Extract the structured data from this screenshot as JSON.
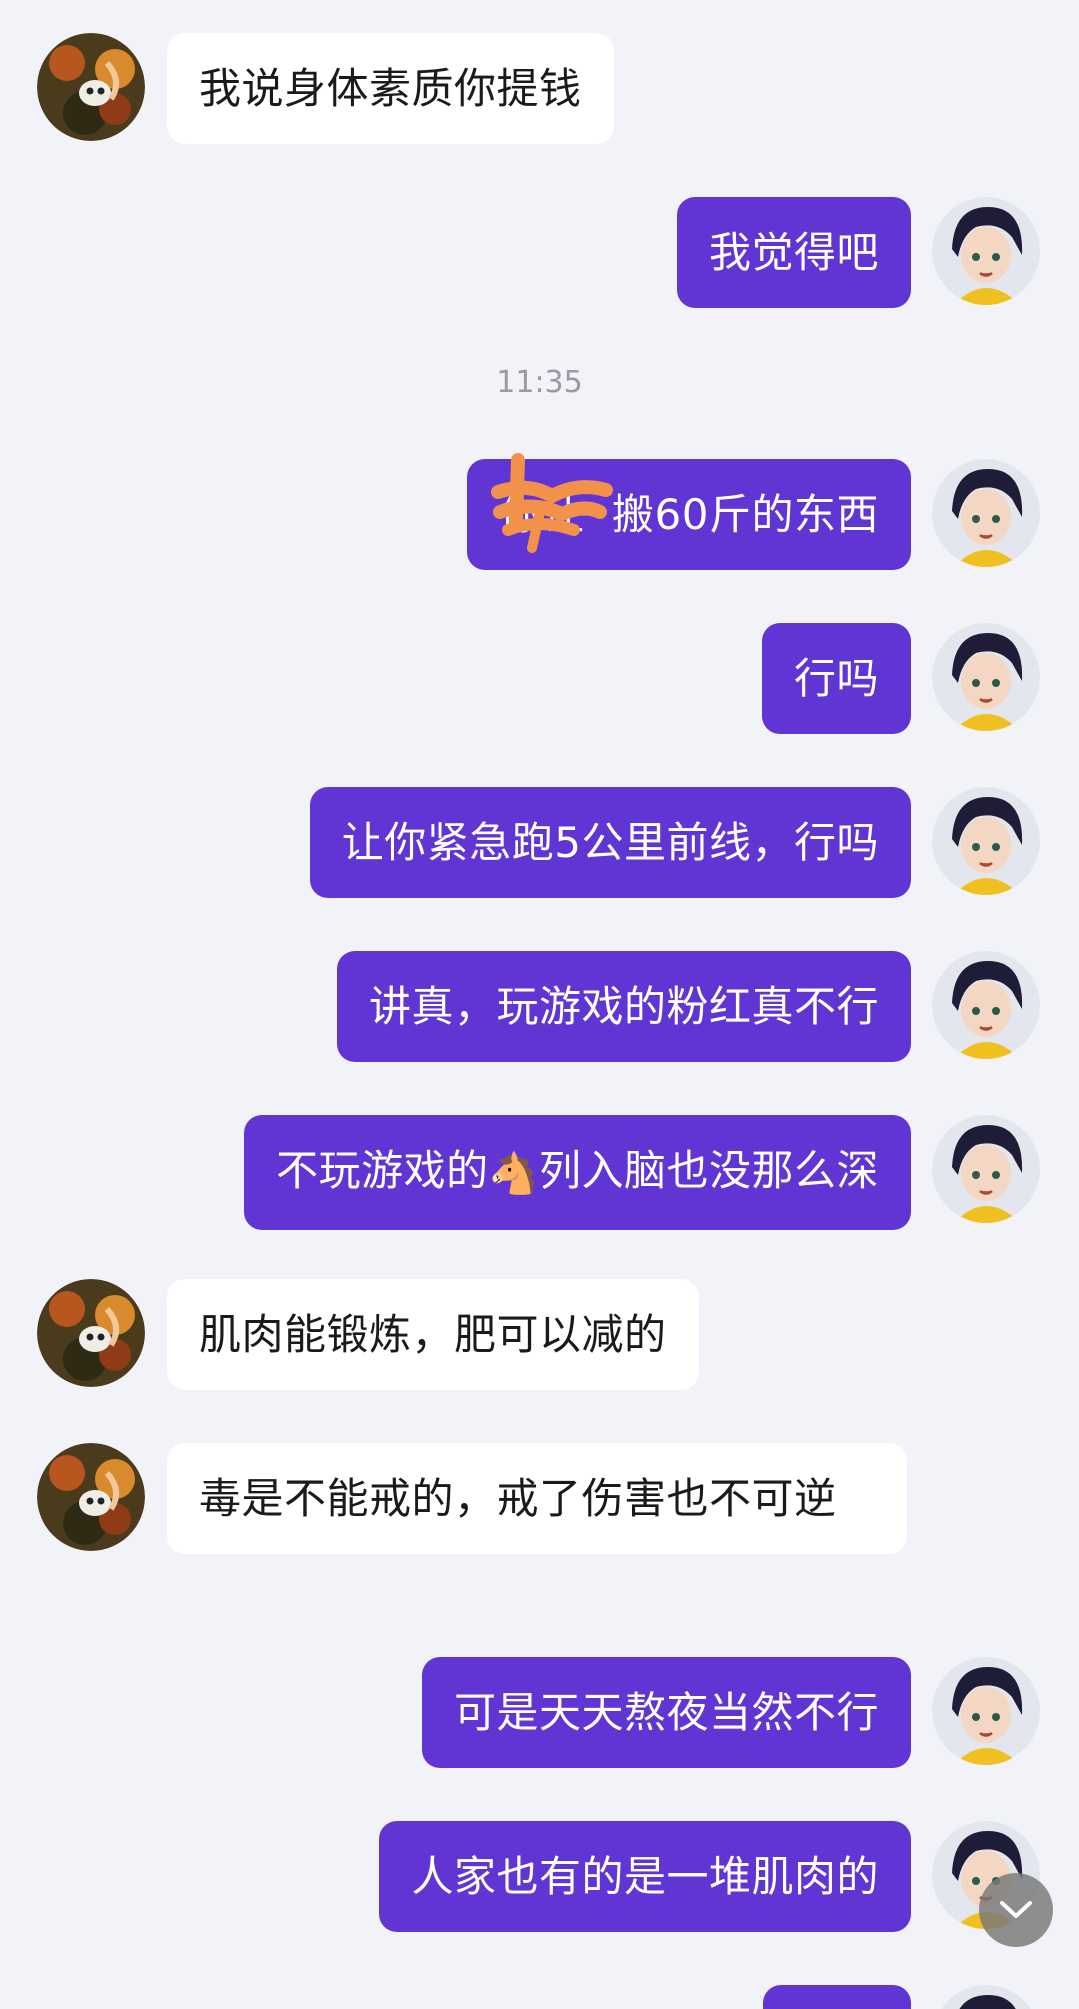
{
  "messages": [
    {
      "side": "incoming",
      "text": "我说身体素质你提钱"
    },
    {
      "side": "outgoing",
      "text": "我觉得吧"
    },
    {
      "side": "outgoing",
      "text": "你让  搬60斤的东西"
    },
    {
      "side": "outgoing",
      "text": "行吗"
    },
    {
      "side": "outgoing",
      "text": "让你紧急跑5公里前线，行吗"
    },
    {
      "side": "outgoing",
      "text": "讲真，玩游戏的粉红真不行"
    },
    {
      "side": "outgoing",
      "text_before": "不玩游戏的",
      "emoji": "🐴",
      "text_after": "列入脑也没那么深"
    },
    {
      "side": "incoming",
      "text": "肌肉能锻炼，肥可以减的"
    },
    {
      "side": "incoming",
      "text": "毒是不能戒的，戒了伤害也不可逆"
    },
    {
      "side": "outgoing",
      "text": "可是天天熬夜当然不行"
    },
    {
      "side": "outgoing",
      "text": "人家也有的是一堆肌肉的"
    }
  ],
  "timestamp": "11:35",
  "icons": {
    "incoming_avatar": "contact-avatar-icon",
    "outgoing_avatar": "self-avatar-icon",
    "scroll_down": "chevron-down-icon"
  },
  "colors": {
    "background": "#f2f3f8",
    "outgoing_bubble": "#6135d3",
    "incoming_bubble": "#ffffff",
    "redaction": "#f2924a"
  }
}
